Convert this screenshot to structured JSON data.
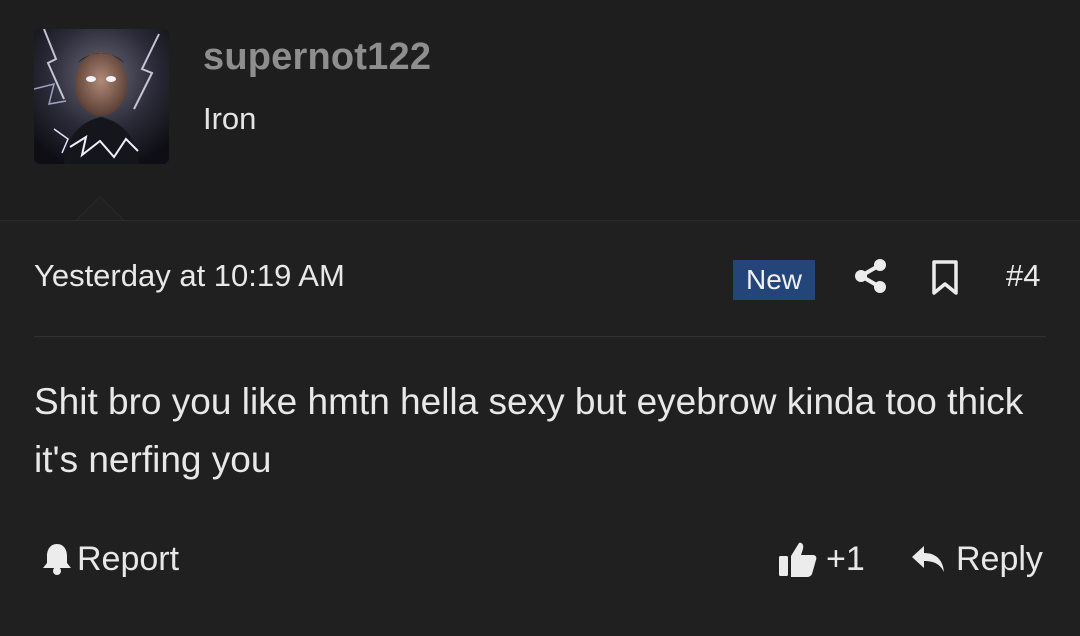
{
  "user": {
    "username": "supernot122",
    "title": "Iron"
  },
  "post": {
    "date": "Yesterday at 10:19 AM",
    "badge": "New",
    "number": "#4",
    "body": "Shit bro you like hmtn hella sexy but eyebrow kinda too thick it's nerfing you"
  },
  "actions": {
    "report_label": "Report",
    "like_label": "+1",
    "reply_label": "Reply"
  },
  "icons": {
    "share": "share-icon",
    "bookmark": "bookmark-icon",
    "report": "bell-icon",
    "like": "thumbs-up-icon",
    "reply": "reply-arrow-icon"
  },
  "colors": {
    "background": "#1c1c1c",
    "username": "#8e8e8e",
    "badge": "#24457a"
  }
}
